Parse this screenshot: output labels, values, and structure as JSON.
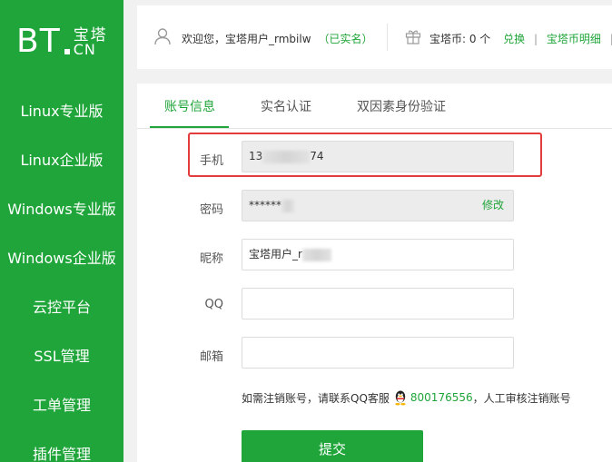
{
  "brand": {
    "bt": "BT",
    "cn_top": "宝塔",
    "cn_bottom": "CN"
  },
  "sidebar": {
    "items": [
      {
        "label": "Linux专业版"
      },
      {
        "label": "Linux企业版"
      },
      {
        "label": "Windows专业版"
      },
      {
        "label": "Windows企业版"
      },
      {
        "label": "云控平台"
      },
      {
        "label": "SSL管理"
      },
      {
        "label": "工单管理"
      },
      {
        "label": "插件管理"
      }
    ]
  },
  "topbar": {
    "welcome": "欢迎您，宝塔用户_rmbilw",
    "verified": "（已实名）",
    "coin_text": "宝塔币: 0 个",
    "exchange": "兑换",
    "sep1": "|",
    "detail": "宝塔币明细",
    "sep2": "|"
  },
  "tabs": [
    {
      "label": "账号信息",
      "active": true
    },
    {
      "label": "实名认证",
      "active": false
    },
    {
      "label": "双因素身份验证",
      "active": false
    }
  ],
  "form": {
    "phone_label": "手机",
    "phone_prefix": "13",
    "phone_suffix": "74",
    "password_label": "密码",
    "password_value": "******",
    "modify_label": "修改",
    "nickname_label": "昵称",
    "nickname_value": "宝塔用户_r",
    "qq_label": "QQ",
    "qq_value": "",
    "email_label": "邮箱",
    "email_value": ""
  },
  "note": {
    "prefix": "如需注销账号，请联系QQ客服",
    "qq_number": "800176556",
    "suffix": "，人工审核注销账号"
  },
  "submit_label": "提交",
  "colors": {
    "brand_green": "#20a53a",
    "highlight_red": "#e23c3c"
  }
}
